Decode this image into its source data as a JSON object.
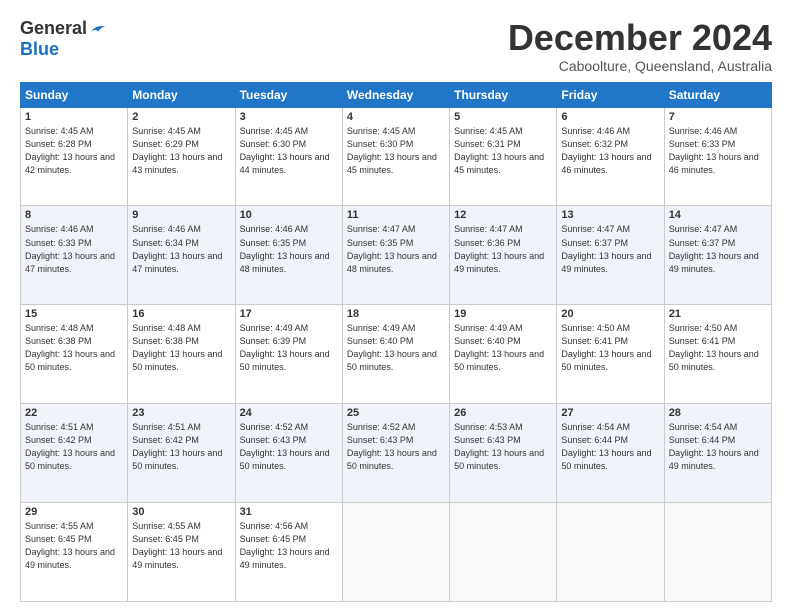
{
  "logo": {
    "general": "General",
    "blue": "Blue"
  },
  "title": "December 2024",
  "location": "Caboolture, Queensland, Australia",
  "days_of_week": [
    "Sunday",
    "Monday",
    "Tuesday",
    "Wednesday",
    "Thursday",
    "Friday",
    "Saturday"
  ],
  "weeks": [
    [
      {
        "day": "1",
        "sunrise": "4:45 AM",
        "sunset": "6:28 PM",
        "daylight": "13 hours and 42 minutes."
      },
      {
        "day": "2",
        "sunrise": "4:45 AM",
        "sunset": "6:29 PM",
        "daylight": "13 hours and 43 minutes."
      },
      {
        "day": "3",
        "sunrise": "4:45 AM",
        "sunset": "6:30 PM",
        "daylight": "13 hours and 44 minutes."
      },
      {
        "day": "4",
        "sunrise": "4:45 AM",
        "sunset": "6:30 PM",
        "daylight": "13 hours and 45 minutes."
      },
      {
        "day": "5",
        "sunrise": "4:45 AM",
        "sunset": "6:31 PM",
        "daylight": "13 hours and 45 minutes."
      },
      {
        "day": "6",
        "sunrise": "4:46 AM",
        "sunset": "6:32 PM",
        "daylight": "13 hours and 46 minutes."
      },
      {
        "day": "7",
        "sunrise": "4:46 AM",
        "sunset": "6:33 PM",
        "daylight": "13 hours and 46 minutes."
      }
    ],
    [
      {
        "day": "8",
        "sunrise": "4:46 AM",
        "sunset": "6:33 PM",
        "daylight": "13 hours and 47 minutes."
      },
      {
        "day": "9",
        "sunrise": "4:46 AM",
        "sunset": "6:34 PM",
        "daylight": "13 hours and 47 minutes."
      },
      {
        "day": "10",
        "sunrise": "4:46 AM",
        "sunset": "6:35 PM",
        "daylight": "13 hours and 48 minutes."
      },
      {
        "day": "11",
        "sunrise": "4:47 AM",
        "sunset": "6:35 PM",
        "daylight": "13 hours and 48 minutes."
      },
      {
        "day": "12",
        "sunrise": "4:47 AM",
        "sunset": "6:36 PM",
        "daylight": "13 hours and 49 minutes."
      },
      {
        "day": "13",
        "sunrise": "4:47 AM",
        "sunset": "6:37 PM",
        "daylight": "13 hours and 49 minutes."
      },
      {
        "day": "14",
        "sunrise": "4:47 AM",
        "sunset": "6:37 PM",
        "daylight": "13 hours and 49 minutes."
      }
    ],
    [
      {
        "day": "15",
        "sunrise": "4:48 AM",
        "sunset": "6:38 PM",
        "daylight": "13 hours and 50 minutes."
      },
      {
        "day": "16",
        "sunrise": "4:48 AM",
        "sunset": "6:38 PM",
        "daylight": "13 hours and 50 minutes."
      },
      {
        "day": "17",
        "sunrise": "4:49 AM",
        "sunset": "6:39 PM",
        "daylight": "13 hours and 50 minutes."
      },
      {
        "day": "18",
        "sunrise": "4:49 AM",
        "sunset": "6:40 PM",
        "daylight": "13 hours and 50 minutes."
      },
      {
        "day": "19",
        "sunrise": "4:49 AM",
        "sunset": "6:40 PM",
        "daylight": "13 hours and 50 minutes."
      },
      {
        "day": "20",
        "sunrise": "4:50 AM",
        "sunset": "6:41 PM",
        "daylight": "13 hours and 50 minutes."
      },
      {
        "day": "21",
        "sunrise": "4:50 AM",
        "sunset": "6:41 PM",
        "daylight": "13 hours and 50 minutes."
      }
    ],
    [
      {
        "day": "22",
        "sunrise": "4:51 AM",
        "sunset": "6:42 PM",
        "daylight": "13 hours and 50 minutes."
      },
      {
        "day": "23",
        "sunrise": "4:51 AM",
        "sunset": "6:42 PM",
        "daylight": "13 hours and 50 minutes."
      },
      {
        "day": "24",
        "sunrise": "4:52 AM",
        "sunset": "6:43 PM",
        "daylight": "13 hours and 50 minutes."
      },
      {
        "day": "25",
        "sunrise": "4:52 AM",
        "sunset": "6:43 PM",
        "daylight": "13 hours and 50 minutes."
      },
      {
        "day": "26",
        "sunrise": "4:53 AM",
        "sunset": "6:43 PM",
        "daylight": "13 hours and 50 minutes."
      },
      {
        "day": "27",
        "sunrise": "4:54 AM",
        "sunset": "6:44 PM",
        "daylight": "13 hours and 50 minutes."
      },
      {
        "day": "28",
        "sunrise": "4:54 AM",
        "sunset": "6:44 PM",
        "daylight": "13 hours and 49 minutes."
      }
    ],
    [
      {
        "day": "29",
        "sunrise": "4:55 AM",
        "sunset": "6:45 PM",
        "daylight": "13 hours and 49 minutes."
      },
      {
        "day": "30",
        "sunrise": "4:55 AM",
        "sunset": "6:45 PM",
        "daylight": "13 hours and 49 minutes."
      },
      {
        "day": "31",
        "sunrise": "4:56 AM",
        "sunset": "6:45 PM",
        "daylight": "13 hours and 49 minutes."
      },
      null,
      null,
      null,
      null
    ]
  ]
}
